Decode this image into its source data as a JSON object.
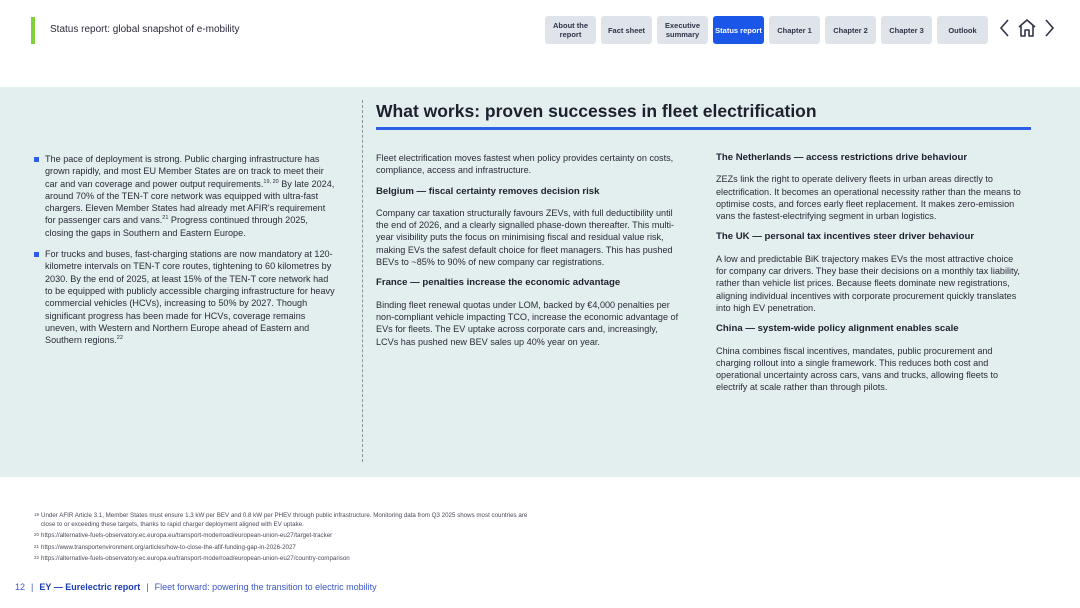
{
  "header": {
    "title": "Status report: global snapshot of e-mobility",
    "tabs": [
      {
        "label": "About the report"
      },
      {
        "label": "Fact sheet"
      },
      {
        "label": "Executive summary"
      },
      {
        "label": "Status report"
      },
      {
        "label": "Chapter 1"
      },
      {
        "label": "Chapter 2"
      },
      {
        "label": "Chapter 3"
      },
      {
        "label": "Outlook"
      }
    ],
    "active_tab": "Status report",
    "icons": [
      "chevron-left-icon",
      "home-icon",
      "chevron-right-icon"
    ]
  },
  "colors": {
    "accent_green": "#7fd13b",
    "primary_blue": "#2d5fe6",
    "band_bg": "#e3eeee",
    "tab_bg": "#dfe3ea"
  },
  "section": {
    "title": "What works: proven successes in fleet electrification"
  },
  "left_column": {
    "bullets": [
      {
        "text_a": "The pace of deployment is strong. Public charging infrastructure has grown rapidly, and most EU Member States are on track to meet their car and van coverage and power output requirements.",
        "ref_a": "19, 20",
        "text_b": " By late 2024, around 70% of the TEN-T core network was equipped with ultra-fast chargers. Eleven Member States had already met AFIR's requirement for passenger cars and vans.",
        "ref_b": "21",
        "text_c": " Progress continued through 2025, closing the gaps in Southern and Eastern Europe."
      },
      {
        "text_a": "For trucks and buses, fast-charging stations are now mandatory at 120-kilometre intervals on TEN-T core routes, tightening to 60 kilometres by 2030. By the end of 2025, at least 15% of the TEN-T core network had to be equipped with publicly accessible charging infrastructure for heavy commercial vehicles (HCVs), increasing to 50% by 2027. Though significant progress has been made for HCVs, coverage remains uneven, with Western and Northern Europe ahead of Eastern and Southern regions.",
        "ref_a": "22"
      }
    ]
  },
  "middle_column": {
    "intro": "Fleet electrification moves fastest when policy provides certainty on costs, compliance, access and infrastructure.",
    "sections": [
      {
        "heading": "Belgium — fiscal certainty removes decision risk",
        "body": "Company car taxation structurally favours ZEVs, with full deductibility until the end of 2026, and a clearly signalled phase-down thereafter. This multi-year visibility puts the focus on minimising fiscal and residual value risk, making EVs the safest default choice for fleet managers. This has pushed BEVs to ~85% to 90% of new company car registrations."
      },
      {
        "heading": "France — penalties increase the economic advantage",
        "body": "Binding fleet renewal quotas under LOM, backed by €4,000 penalties per non-compliant vehicle impacting TCO, increase the economic advantage of EVs for fleets. The EV uptake across corporate cars and, increasingly, LCVs has pushed new BEV sales up 40% year on year."
      }
    ]
  },
  "right_column": {
    "sections": [
      {
        "heading": "The Netherlands — access restrictions drive behaviour",
        "body": "ZEZs link the right to operate delivery fleets in urban areas directly to electrification. It becomes an operational necessity rather than the means to optimise costs, and forces early fleet replacement. It makes zero-emission vans the fastest-electrifying segment in urban logistics."
      },
      {
        "heading": "The UK — personal tax incentives steer driver behaviour",
        "body": "A low and predictable BiK trajectory makes EVs the most attractive choice for company car drivers. They base their decisions on a monthly tax liability, rather than vehicle list prices. Because fleets dominate new registrations, aligning individual incentives with corporate procurement quickly translates into high EV penetration."
      },
      {
        "heading": "China — system-wide policy alignment enables scale",
        "body": "China combines fiscal incentives, mandates, public procurement and charging rollout into a single framework. This reduces both cost and operational uncertainty across cars, vans and trucks, allowing fleets to electrify at scale rather than through pilots."
      }
    ]
  },
  "footnotes": [
    {
      "num": "19",
      "text": "Under AFIR Article 3.1, Member States must ensure 1.3 kW per BEV and 0.8 kW per PHEV through public infrastructure. Monitoring data from Q3 2025 shows most countries are close to or exceeding these targets, thanks to rapid charger deployment aligned with EV uptake."
    },
    {
      "num": "20",
      "text": "https://alternative-fuels-observatory.ec.europa.eu/transport-mode/road/european-union-eu27/target-tracker"
    },
    {
      "num": "21",
      "text": "https://www.transportenvironment.org/articles/how-to-close-the-afif-funding-gap-in-2026-2027"
    },
    {
      "num": "22",
      "text": "https://alternative-fuels-observatory.ec.europa.eu/transport-mode/road/european-union-eu27/country-comparison"
    }
  ],
  "footer": {
    "page_number": "12",
    "brand": "EY — Eurelectric report",
    "separator": "|",
    "subtitle": "Fleet forward: powering the transition to electric mobility"
  }
}
